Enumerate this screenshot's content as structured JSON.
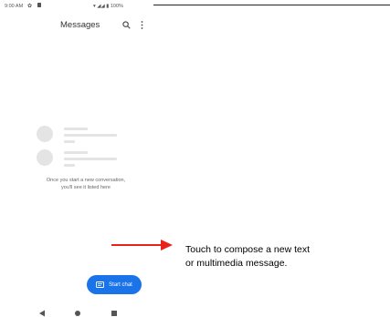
{
  "status_bar": {
    "time": "9:00 AM",
    "right": "100%"
  },
  "app_bar": {
    "title": "Messages",
    "search_icon": "search-icon",
    "more_icon": "more-vert-icon"
  },
  "empty_state": {
    "line1": "Once you start a new conversation,",
    "line2": "you'll see it listed here"
  },
  "fab": {
    "label": "Start chat",
    "icon": "chat-icon",
    "color": "#1a73e8"
  },
  "nav": {
    "back_icon": "back-triangle-icon",
    "home_icon": "home-circle-icon",
    "recent_icon": "recent-square-icon"
  },
  "annotation": {
    "line1": "Touch to compose a new text",
    "line2": "or multimedia message.",
    "arrow_color": "#e8221b"
  }
}
